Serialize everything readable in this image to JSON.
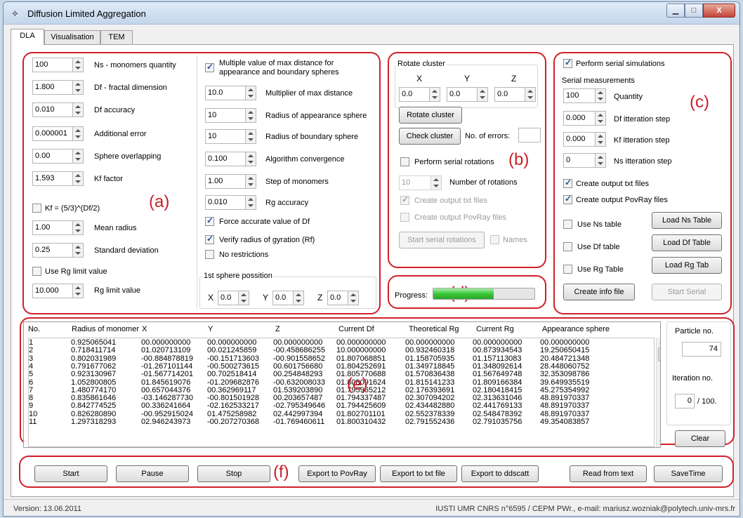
{
  "window": {
    "title": "Diffusion Limited Aggregation",
    "min": "▁",
    "max": "□",
    "close": "X"
  },
  "tabs": [
    "DLA",
    "Visualisation",
    "TEM"
  ],
  "section_labels": {
    "a": "(a)",
    "b": "(b)",
    "c": "(c)",
    "d": "(d)",
    "e": "(e)",
    "f": "(f)"
  },
  "panel_a": {
    "fields": [
      {
        "value": "100",
        "label": "Ns - monomers quantity"
      },
      {
        "value": "1.800",
        "label": "Df - fractal dimension"
      },
      {
        "value": "0.010",
        "label": "Df accuracy"
      },
      {
        "value": "0.000001",
        "label": "Additional error"
      },
      {
        "value": "0.00",
        "label": "Sphere overlapping"
      },
      {
        "value": "1.593",
        "label": "Kf factor"
      }
    ],
    "kf_formula_label": "Kf = (5/3)^(Df/2)",
    "fields2": [
      {
        "value": "1.00",
        "label": "Mean radius"
      },
      {
        "value": "0.25",
        "label": "Standard deviation"
      }
    ],
    "use_rg_limit_label": "Use Rg limit value",
    "rg_limit": {
      "value": "10.000",
      "label": "Rg limit value"
    },
    "multiple_label_1": "Multiple value of max distance for",
    "multiple_label_2": "appearance and boundary spheres",
    "fields_right": [
      {
        "value": "10.0",
        "label": "Multiplier of max distance"
      },
      {
        "value": "10",
        "label": "Radius of appearance sphere"
      },
      {
        "value": "10",
        "label": "Radius of boundary sphere"
      },
      {
        "value": "0.100",
        "label": "Algorithm convergence"
      },
      {
        "value": "1.00",
        "label": "Step of monomers"
      },
      {
        "value": "0.010",
        "label": "Rg accuracy"
      }
    ],
    "force_label": "Force accurate value of Df",
    "verify_label": "Verify radius of gyration (Rf)",
    "norestrict_label": "No restrictions",
    "first_sphere": {
      "title": "1st sphere possition",
      "x_label": "X",
      "x": "0.0",
      "y_label": "Y",
      "y": "0.0",
      "z_label": "Z",
      "z": "0.0"
    }
  },
  "panel_b": {
    "title": "Rotate cluster",
    "axes": [
      "X",
      "Y",
      "Z"
    ],
    "values": [
      "0.0",
      "0.0",
      "0.0"
    ],
    "rotate_btn": "Rotate cluster",
    "check_btn": "Check cluster",
    "errors_label": "No. of errors:",
    "errors_value": "",
    "serial_label": "Perform serial rotations",
    "rotations_value": "10",
    "rotations_label": "Number of rotations",
    "out_txt_label": "Create output txt files",
    "out_pov_label": "Create output PovRay files",
    "start_serial_btn": "Start serial rotations",
    "names_label": "Names"
  },
  "panel_c": {
    "perform_label": "Perform serial simulations",
    "serial_title": "Serial measurements",
    "fields": [
      {
        "value": "100",
        "label": "Quantity"
      },
      {
        "value": "0.000",
        "label": "Df itteration step"
      },
      {
        "value": "0.000",
        "label": "Kf itteration step"
      },
      {
        "value": "0",
        "label": "Ns itteration step"
      }
    ],
    "out_txt_label": "Create output txt files",
    "out_pov_label": "Create output PovRay files",
    "ns_table_label": "Use Ns table",
    "ns_table_btn": "Load Ns Table",
    "df_table_label": "Use Df table",
    "df_table_btn": "Load Df Table",
    "rg_table_label": "Use Rg Table",
    "rg_table_btn": "Load Rg Tab",
    "info_btn": "Create info file",
    "start_serial_btn": "Start Serial"
  },
  "panel_d": {
    "label": "Progress:",
    "progress": 0.6
  },
  "table": {
    "columns": [
      "No.",
      "Radius of monomer",
      "X",
      "Y",
      "Z",
      "Current Df",
      "Theoretical Rg",
      "Current Rg",
      "Appearance sphere"
    ],
    "rows": [
      [
        "1",
        "0.925065041",
        "00.000000000",
        "00.000000000",
        "00.000000000",
        "00.000000000",
        "00.000000000",
        "00.000000000",
        "00.000000000"
      ],
      [
        "2",
        "0.718411714",
        "01.020713109",
        "00.021245859",
        "-00.458686255",
        "10.000000000",
        "00.932460318",
        "00.873934543",
        "19.250650415"
      ],
      [
        "3",
        "0.802031989",
        "-00.884878819",
        "-00.151713603",
        "-00.901558652",
        "01.807068851",
        "01.158705935",
        "01.157113083",
        "20.484721348"
      ],
      [
        "4",
        "0.791677062",
        "-01.267101144",
        "-00.500273615",
        "00.601756680",
        "01.804252691",
        "01.349718845",
        "01.348092614",
        "28.448060752"
      ],
      [
        "5",
        "0.923130967",
        "-01.567714201",
        "00.702518414",
        "00.254848293",
        "01.805770688",
        "01.570836438",
        "01.567649748",
        "32.353098786"
      ],
      [
        "6",
        "1.052800805",
        "01.845619076",
        "-01.209682876",
        "-00.632008033",
        "01.808091624",
        "01.815141233",
        "01.809166384",
        "39.649935519"
      ],
      [
        "7",
        "1.480774170",
        "00.657044376",
        "00.362969117",
        "01.539203890",
        "01.795965212",
        "02.176393691",
        "02.180418415",
        "45.275354992"
      ],
      [
        "8",
        "0.835861646",
        "-03.146287730",
        "-00.801501928",
        "00.203657487",
        "01.794337487",
        "02.307094202",
        "02.313631046",
        "48.891970337"
      ],
      [
        "9",
        "0.842774525",
        "00.336241664",
        "-02.162533217",
        "-02.795349646",
        "01.794425609",
        "02.434482880",
        "02.441769133",
        "48.891970337"
      ],
      [
        "10",
        "0.826280890",
        "-00.952915024",
        "01.475258982",
        "02.442997394",
        "01.802701101",
        "02.552378339",
        "02.548478392",
        "48.891970337"
      ],
      [
        "11",
        "1.297318293",
        "02.946243973",
        "-00.207270368",
        "-01.769460611",
        "01.800310432",
        "02.791552436",
        "02.791035756",
        "49.354083857"
      ]
    ]
  },
  "side": {
    "particle_label": "Particle no.",
    "particle_value": "74",
    "iteration_label": "Iteration no.",
    "iteration_value": "0",
    "iteration_total": "/  100.",
    "clear_btn": "Clear"
  },
  "bottom": {
    "start": "Start",
    "pause": "Pause",
    "stop": "Stop",
    "export_povray": "Export to PovRay",
    "export_txt": "Export to txt file",
    "export_ddscatt": "Export to ddscatt",
    "read_text": "Read from text",
    "save_time": "SaveTime"
  },
  "status": {
    "version": "Version: 13.06.2011",
    "credit": "IUSTI UMR CNRS n°6595 / CEPM PWr., e-mail: mariusz.wozniak@polytech.univ-mrs.fr"
  },
  "colors": {
    "annotation_red": "#d0202a",
    "progress_green": "#3cc83c"
  }
}
